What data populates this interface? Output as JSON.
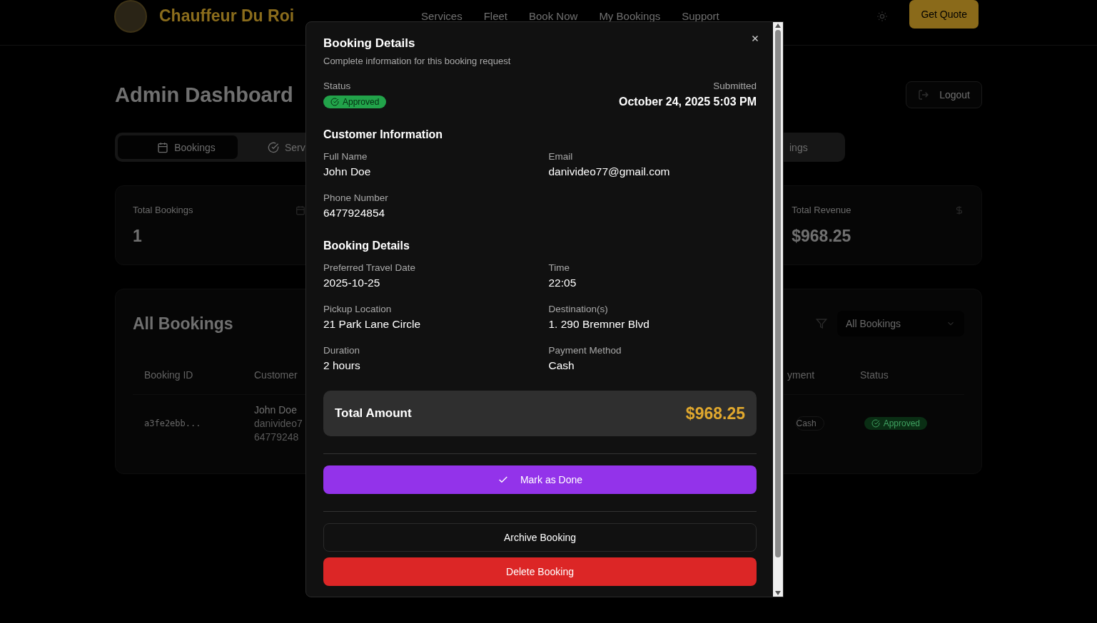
{
  "header": {
    "brand": "Chauffeur Du Roi",
    "nav": [
      "Services",
      "Fleet",
      "Book Now",
      "My Bookings",
      "Support"
    ],
    "cta": "Get Quote"
  },
  "dashboard": {
    "title": "Admin Dashboard",
    "logout": "Logout",
    "tabs": [
      {
        "label": "Bookings",
        "selected": true,
        "kind": "calendar"
      },
      {
        "label": "Serv",
        "selected": false,
        "kind": "check"
      },
      {
        "label": "ings",
        "selected": false,
        "kind": "none"
      }
    ],
    "stats": [
      {
        "label": "Total Bookings",
        "value": "1",
        "kind": "calendar"
      },
      {
        "label": "Total Revenue",
        "value": "$968.25",
        "kind": "dollar"
      }
    ],
    "bookings": {
      "title": "All Bookings",
      "filter": "All Bookings",
      "columns_left": [
        "Booking ID",
        "Customer"
      ],
      "columns_right": [
        "yment",
        "Status"
      ],
      "row": {
        "id": "a3fe2ebb...",
        "customer": [
          "John Doe",
          "danivideo7",
          "64779248"
        ],
        "payment": "Cash",
        "status": {
          "label": "Approved",
          "kind": "approved"
        }
      }
    }
  },
  "modal": {
    "title": "Booking Details",
    "subtitle": "Complete information for this booking request",
    "status_label": "Status",
    "status": {
      "label": "Approved",
      "kind": "approved"
    },
    "submitted_label": "Submitted",
    "submitted": "October 24, 2025 5:03 PM",
    "sections": [
      {
        "title": "Customer Information",
        "fields": [
          {
            "label": "Full Name",
            "value": "John Doe"
          },
          {
            "label": "Email",
            "value": "danivideo77@gmail.com"
          },
          {
            "label": "Phone Number",
            "value": "6477924854"
          }
        ]
      },
      {
        "title": "Booking Details",
        "fields": [
          {
            "label": "Preferred Travel Date",
            "value": "2025-10-25"
          },
          {
            "label": "Time",
            "value": "22:05"
          },
          {
            "label": "Pickup Location",
            "value": "21 Park Lane Circle"
          },
          {
            "label": "Destination(s)",
            "value": "1. 290 Bremner Blvd"
          },
          {
            "label": "Duration",
            "value": "2 hours"
          },
          {
            "label": "Payment Method",
            "value": "Cash"
          }
        ]
      }
    ],
    "total_label": "Total Amount",
    "total": "$968.25",
    "actions": [
      {
        "label": "Mark as Done",
        "kind": "primary"
      },
      {
        "label": "Archive Booking",
        "kind": "outline"
      },
      {
        "label": "Delete Booking",
        "kind": "danger"
      }
    ]
  }
}
